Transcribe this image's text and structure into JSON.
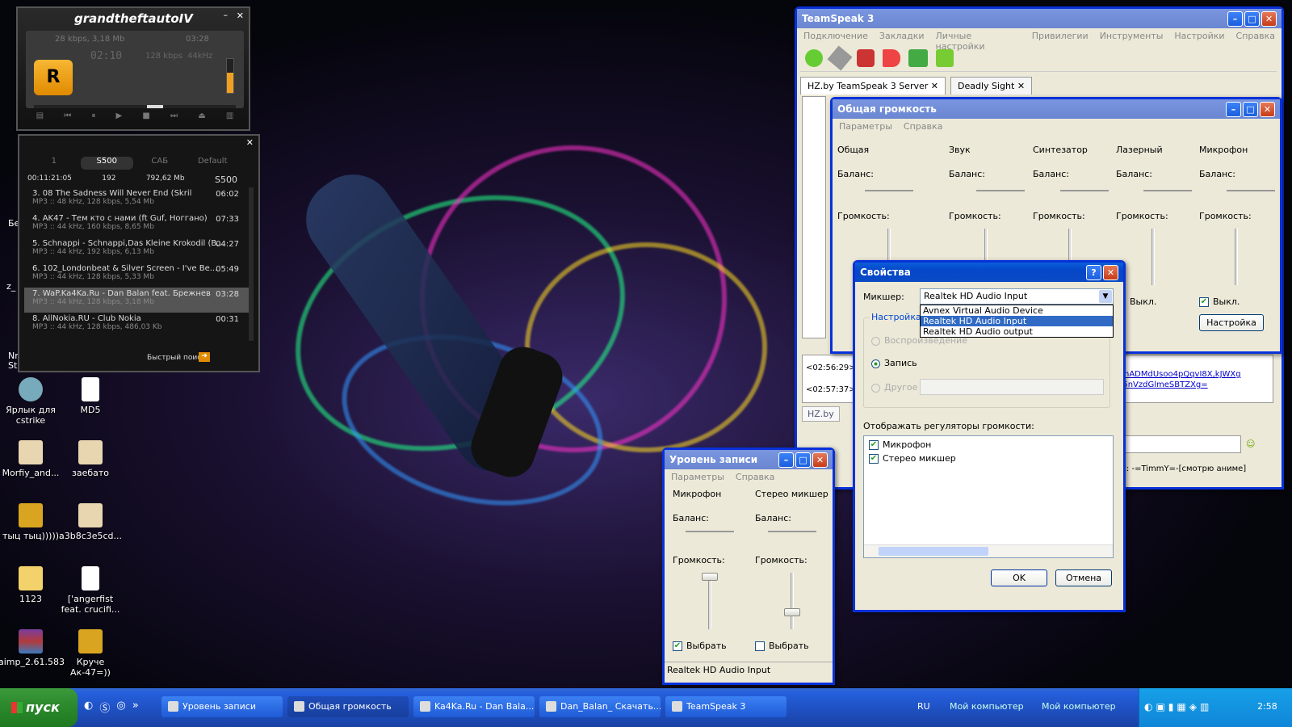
{
  "player": {
    "logo": "grandtheftautoIV",
    "info_line": "28 kbps, 3,18 Mb",
    "time_small": "03:28",
    "time": "02:10",
    "bitrate": "128 kbps",
    "khz": "44kHz"
  },
  "playlist": {
    "tabs": [
      "1",
      "S500",
      "САБ",
      "Default"
    ],
    "summary": {
      "total_time": "00:11:21:05",
      "count": "192",
      "size": "792,62 Mb",
      "name": "S500"
    },
    "items": [
      {
        "title": "3. 08 The Sadness Will Never End (Skril",
        "meta": "MP3 :: 48 kHz, 128 kbps, 5,54 Mb",
        "dur": "06:02"
      },
      {
        "title": "4. AK47 - Тем кто с нами (ft Guf, Ноггано)",
        "meta": "MP3 :: 44 kHz, 160 kbps, 8,65 Mb",
        "dur": "07:33"
      },
      {
        "title": "5. Schnappi - Schnappi,Das Kleine Krokodil (B...",
        "meta": "MP3 :: 44 kHz, 192 kbps, 6,13 Mb",
        "dur": "04:27"
      },
      {
        "title": "6. 102_Londonbeat & Silver Screen - I've Be...",
        "meta": "MP3 :: 44 kHz, 128 kbps, 5,33 Mb",
        "dur": "05:49"
      },
      {
        "title": "7. WaP.Ka4Ka.Ru - Dan Balan feat. Брежнев",
        "meta": "MP3 :: 44 kHz, 128 kbps, 3,18 Mb",
        "dur": "03:28"
      },
      {
        "title": "8. AllNokia.RU - Club Nokia",
        "meta": "MP3 :: 44 kHz, 128 kbps, 486,03 Kb",
        "dur": "00:31"
      }
    ],
    "search_label": "Быстрый поис"
  },
  "desktop_icons": [
    {
      "label": "Ярлык для cstrike"
    },
    {
      "label": "MD5"
    },
    {
      "label": "Morfiy_and..."
    },
    {
      "label": "заебато"
    },
    {
      "label": "тыц тыц)))))"
    },
    {
      "label": "a3b8c3e5cd..."
    },
    {
      "label": "1123"
    },
    {
      "label": "['angerfist feat. crucifi..."
    },
    {
      "label": "aimp_2.61.583"
    },
    {
      "label": "Круче Ак-47=))"
    }
  ],
  "teamspeak": {
    "title": "TeamSpeak 3",
    "menu": [
      "Подключение",
      "Закладки",
      "Личные настройки",
      "Привилегии",
      "Инструменты",
      "Настройки",
      "Справка"
    ],
    "tabs": [
      "HZ.by TeamSpeak 3 Server",
      "Deadly Sight"
    ],
    "log": [
      "<02:56:29>",
      "<02:57:37>"
    ],
    "link1": "isnADMdUsoo4pQqvI8X,kJWXg",
    "link2": "q5nVzdGlmeSBTZXg=",
    "status": "н как: -=TimmY=-[смотрю аниме]",
    "hz_tab": "HZ.by"
  },
  "volume": {
    "title": "Общая громкость",
    "menu": [
      "Параметры",
      "Справка"
    ],
    "columns": [
      "Общая",
      "Звук",
      "Синтезатор",
      "Лазерный",
      "Микрофон"
    ],
    "balance": "Баланс:",
    "volume": "Громкость:",
    "mute": "Выкл.",
    "settings": "Настройка"
  },
  "props": {
    "title": "Свойства",
    "mixer_label": "Микшер:",
    "mixer_value": "Realtek HD Audio Input",
    "options": [
      "Avnex Virtual Audio Device",
      "Realtek HD Audio Input",
      "Realtek HD Audio output"
    ],
    "group_label": "Настройка г",
    "radio_playback": "Воспроизведение",
    "radio_record": "Запись",
    "radio_other": "Другое",
    "show_label": "Отображать регуляторы громкости:",
    "checks": [
      "Микрофон",
      "Стерео микшер"
    ],
    "ok": "OK",
    "cancel": "Отмена"
  },
  "record": {
    "title": "Уровень записи",
    "menu": [
      "Параметры",
      "Справка"
    ],
    "columns": [
      "Микрофон",
      "Стерео микшер"
    ],
    "balance": "Баланс:",
    "volume": "Громкость:",
    "select": "Выбрать",
    "status": "Realtek HD Audio Input"
  },
  "taskbar": {
    "start": "пуск",
    "items": [
      "Уровень записи",
      "Общая громкость",
      "Ka4Ka.Ru - Dan Bala...",
      "Dan_Balan_ Скачать...",
      "TeamSpeak 3"
    ],
    "lang": "RU",
    "tb1": "Мой компьютер",
    "tb2": "Мой компьютер",
    "clock": "2:58"
  },
  "side_texts": {
    "be": "Бе",
    "z": "z_",
    "nr": "Nr",
    "st": "St"
  }
}
